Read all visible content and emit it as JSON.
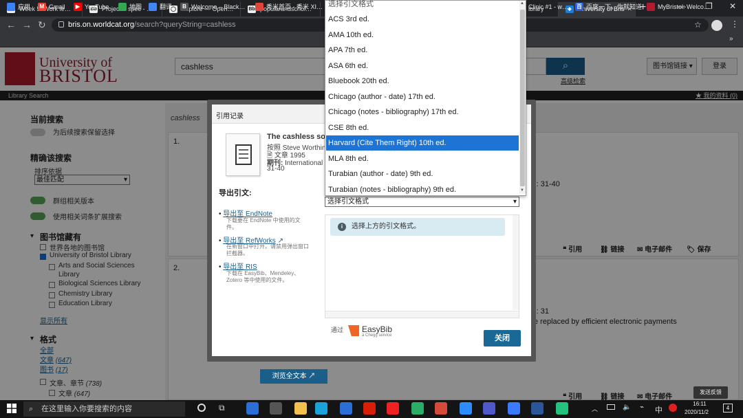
{
  "browser": {
    "tabs": [
      {
        "label": "Week 5: Work le…",
        "fav": "Bb"
      },
      {
        "label": "Project 1 spec - …",
        "fav": "Bb"
      },
      {
        "label": "Explore — Open…",
        "fav": "◯"
      },
      {
        "label": "popularandschol…",
        "fav": "Bb"
      },
      {
        "label": "ibrary",
        "fav": ""
      },
      {
        "label": "University of Bris",
        "fav": "◈"
      }
    ],
    "url_host": "bris.on.worldcat.org",
    "url_path": "/search?queryString=cashless",
    "bookmarks": [
      {
        "label": "应用",
        "color": "#3b82f6"
      },
      {
        "label": "Gmail",
        "color": "#ea4335"
      },
      {
        "label": "YouTube",
        "color": "#ff0000"
      },
      {
        "label": "地图",
        "color": "#34a853"
      },
      {
        "label": "翻译",
        "color": "#4285f4"
      },
      {
        "label": "Welcome – Black…",
        "color": "#555555"
      },
      {
        "label": "秀米首页 - 秀米 XI…",
        "color": "#e0443a"
      },
      {
        "label": "Clinic #1 - w…",
        "color": "#666666"
      },
      {
        "label": "百度一下，你就知道",
        "color": "#2e5fd6"
      },
      {
        "label": "MyBristol: Welco…",
        "color": "#b01c2e"
      }
    ]
  },
  "header": {
    "logo_line1": "University of",
    "logo_line2": "BRISTOL",
    "search_value": "cashless",
    "advanced_label": "高级检索",
    "library_links": "图书馆链接",
    "login": "登录",
    "library_search": "Library Search",
    "my_account": "我的资料 (0)"
  },
  "sidebar": {
    "current_search": "当前搜索",
    "keep_search": "为后续搜索保留选择",
    "refine": "精确该搜索",
    "sort_label": "排序依据",
    "sort_value": "最佳匹配",
    "group_versions": "群组相关版本",
    "use_expansion": "使用相关词条扩展搜索",
    "holdings": "图书馆藏有",
    "holdings_items": [
      {
        "label": "世界各地的图书馆",
        "checked": false
      },
      {
        "label": "University of Bristol Library",
        "checked": true
      },
      {
        "label": "Arts and Social Sciences",
        "checked": false
      },
      {
        "label": "Library",
        "checked": false
      },
      {
        "label": "Biological Sciences Library",
        "checked": false
      },
      {
        "label": "Chemistry Library",
        "checked": false
      },
      {
        "label": "Education Library",
        "checked": false
      }
    ],
    "show_all": "显示所有",
    "format": "格式",
    "format_all": "全部",
    "format_article": "文章",
    "format_article_count": "(647)",
    "format_book": "图书",
    "format_book_count": "(17)",
    "format_chapter": "文章、章节",
    "format_chapter_count": "(738)",
    "format_article2": "文章",
    "format_article2_count": "(647)"
  },
  "results": {
    "query": "cashless",
    "r1_num": "1.",
    "r1_tail": "): 31-40",
    "r2_num": "2.",
    "r2_tail": "): 31",
    "r2_snippet": "e replaced by efficient electronic payments",
    "actions": {
      "cite": "引用",
      "link": "链接",
      "email": "电子邮件",
      "save": "保存"
    },
    "fulltext": "浏览全文本"
  },
  "modal": {
    "title": "引用记录",
    "book_title": "The cashless so",
    "author": "按照 Steve Worthin",
    "type": "文章 1995",
    "journal_label": "期刊:",
    "journal": "International",
    "pages": "31-40",
    "export_title": "导出引文:",
    "export_endnote": "导出至 EndNote",
    "export_endnote_desc1": "下载要在 EndNote 中使用的文",
    "export_endnote_desc2": "件。",
    "export_refworks": "导出至 RefWorks",
    "export_refworks_desc1": "在新窗口中打开。请禁用弹出窗口",
    "export_refworks_desc2": "拦截器。",
    "export_ris": "导出至 RIS",
    "export_ris_desc1": "下载在 EasyBib、Mendeley、",
    "export_ris_desc2": "Zotero 等中使用的文件。",
    "select_placeholder": "选择引文格式",
    "info": "选择上方的引文格式。",
    "via": "通过",
    "easybib": "EasyBib",
    "easybib_sub": "a Chegg service",
    "close": "关闭"
  },
  "dropdown": {
    "top_option": "选择引文格式",
    "options": [
      "ACS 3rd ed.",
      "AMA 10th ed.",
      "APA 7th ed.",
      "ASA 6th ed.",
      "Bluebook 20th ed.",
      "Chicago (author - date) 17th ed.",
      "Chicago (notes - bibliography) 17th ed.",
      "CSE 8th ed.",
      "Harvard (Cite Them Right) 10th ed.",
      "MLA 8th ed.",
      "Turabian (author - date) 9th ed.",
      "Turabian (notes - bibliography) 9th ed."
    ],
    "selected_index": 8
  },
  "taskbar": {
    "search_placeholder": "在这里输入你要搜索的内容",
    "time": "16:11",
    "date": "2020/11/2",
    "lang": "中",
    "feedback": "发送反馈",
    "notif_count": "4"
  }
}
